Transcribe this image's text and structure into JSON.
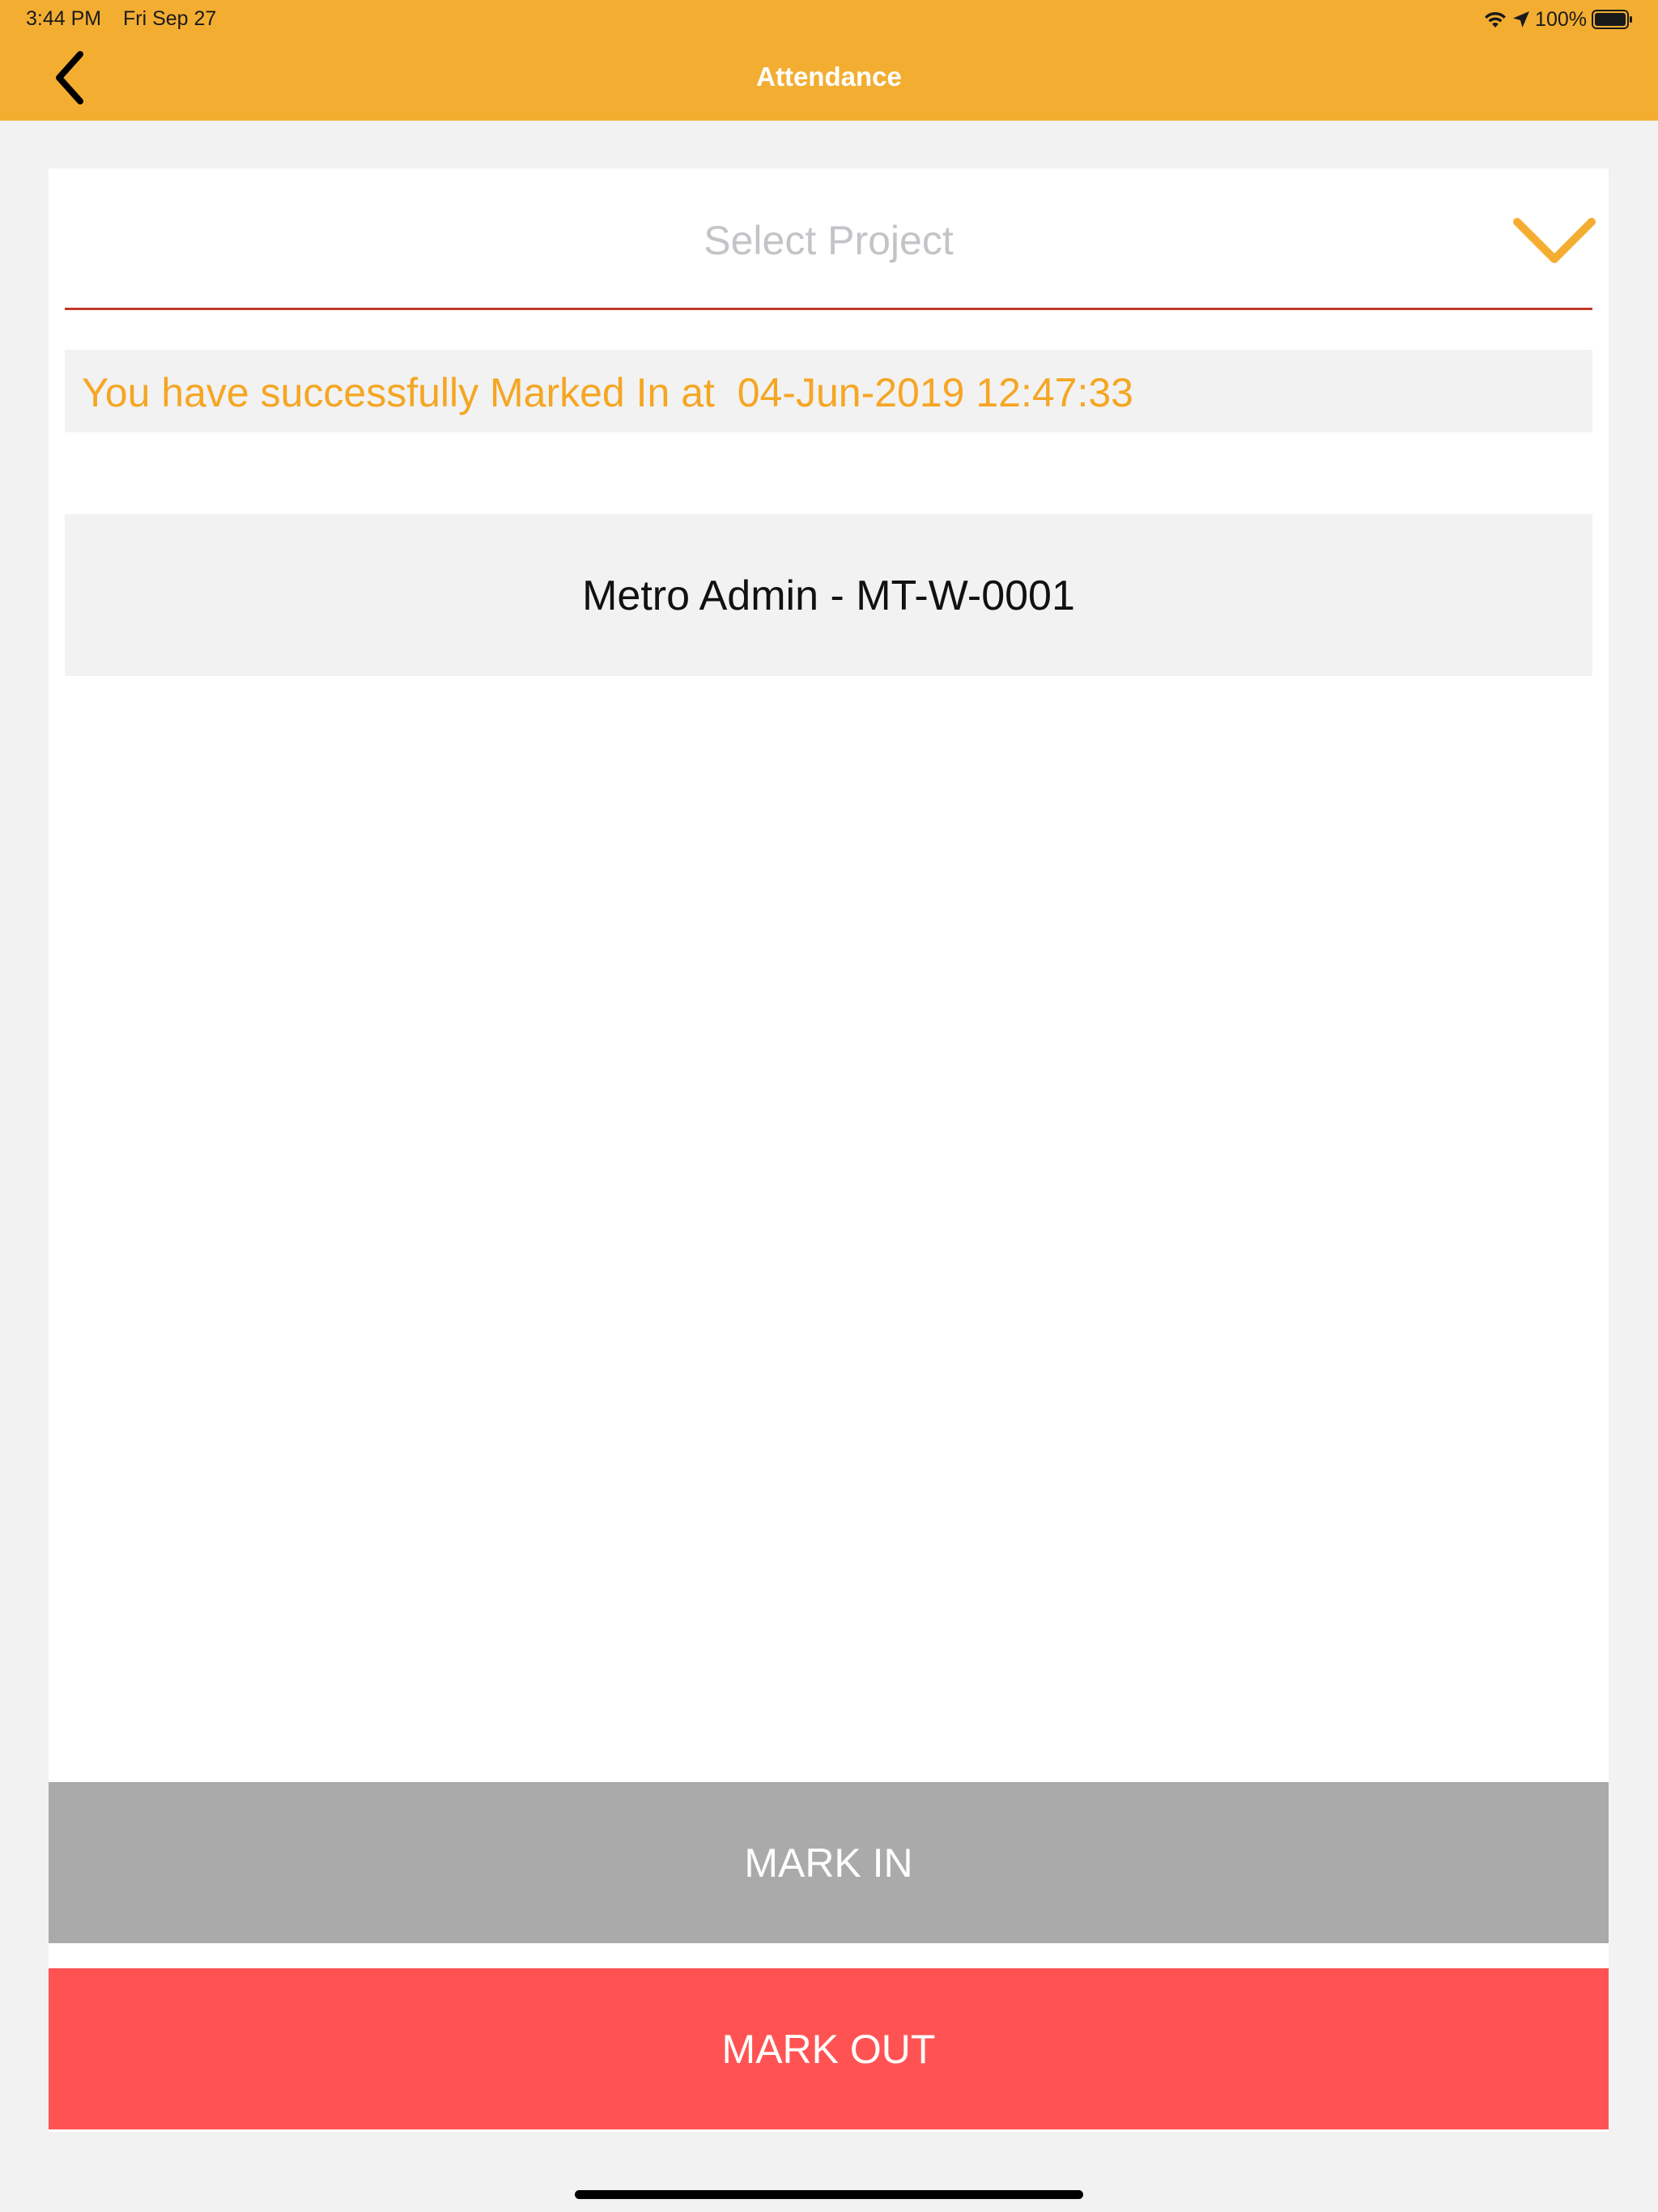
{
  "status_bar": {
    "time": "3:44 PM",
    "date": "Fri Sep 27",
    "battery": "100%"
  },
  "header": {
    "title": "Attendance",
    "color": "#f3ae32"
  },
  "project_select": {
    "placeholder": "Select Project"
  },
  "success_message": "You have successfully Marked In at  04-Jun-2019 12:47:33",
  "project": {
    "name": "Metro Admin - MT-W-0001"
  },
  "actions": {
    "mark_in": "MARK IN",
    "mark_out": "MARK OUT"
  },
  "icons": {
    "back": "chevron-left-icon",
    "dropdown": "chevron-down-icon",
    "wifi": "wifi-icon",
    "location": "location-arrow-icon",
    "battery": "battery-icon"
  },
  "colors": {
    "accent": "#f3ae32",
    "success_text": "#f5a623",
    "underline": "#c0392b",
    "mark_in_bg": "#aaaaaa",
    "mark_out_bg": "#ff5353"
  }
}
